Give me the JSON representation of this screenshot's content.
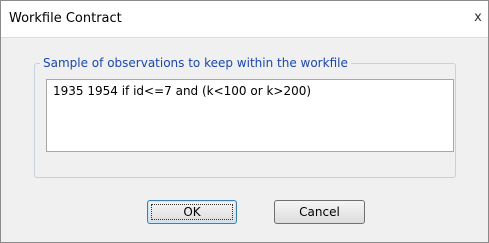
{
  "window": {
    "title": "Workfile Contract",
    "close_glyph": "x"
  },
  "group": {
    "legend": "Sample of observations to keep within the workfile"
  },
  "sample_input": {
    "value": "1935 1954 if id<=7 and (k<100 or k>200)"
  },
  "buttons": {
    "ok_label": "OK",
    "cancel_label": "Cancel"
  }
}
